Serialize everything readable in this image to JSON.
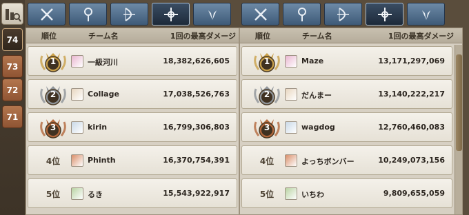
{
  "rounds": [
    "74",
    "73",
    "72",
    "71"
  ],
  "active_round": "74",
  "tabs": [
    {
      "icon": "swords-icon"
    },
    {
      "icon": "staff-icon"
    },
    {
      "icon": "bow-icon"
    },
    {
      "icon": "shield-cross-icon"
    },
    {
      "icon": "wings-icon"
    }
  ],
  "active_tab_index": 3,
  "header": {
    "rank": "順位",
    "team": "チーム名",
    "score": "1回の最高ダメージ"
  },
  "left": {
    "rows": [
      {
        "rank": "1",
        "name": "一級河川",
        "score": "18,382,626,605",
        "medal": "gold"
      },
      {
        "rank": "2",
        "name": "Collage",
        "score": "17,038,526,763",
        "medal": "silver"
      },
      {
        "rank": "3",
        "name": "kirin",
        "score": "16,799,306,803",
        "medal": "bronze"
      },
      {
        "rank": "4位",
        "name": "Phinth",
        "score": "16,370,754,391",
        "medal": ""
      },
      {
        "rank": "5位",
        "name": "るき",
        "score": "15,543,922,917",
        "medal": ""
      }
    ]
  },
  "right": {
    "rows": [
      {
        "rank": "1",
        "name": "Maze",
        "score": "13,171,297,069",
        "medal": "gold"
      },
      {
        "rank": "2",
        "name": "だんまー",
        "score": "13,140,222,217",
        "medal": "silver"
      },
      {
        "rank": "3",
        "name": "wagdog",
        "score": "12,760,460,083",
        "medal": "bronze"
      },
      {
        "rank": "4位",
        "name": "よっちボンバー",
        "score": "10,249,073,156",
        "medal": ""
      },
      {
        "rank": "5位",
        "name": "いちわ",
        "score": "9,809,655,059",
        "medal": ""
      }
    ]
  },
  "colors": {
    "gold": "#c9a04a",
    "silver": "#8f9499",
    "bronze": "#b3683c"
  }
}
